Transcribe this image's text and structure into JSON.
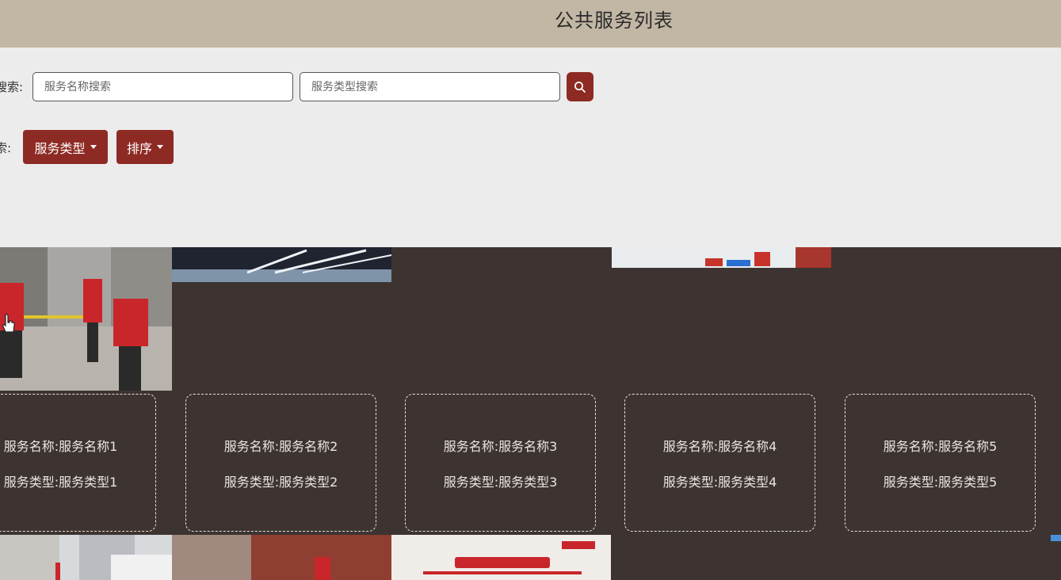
{
  "header": {
    "title": "公共服务列表"
  },
  "search": {
    "label": "搜索:",
    "name_placeholder": "服务名称搜索",
    "type_placeholder": "服务类型搜索",
    "button_icon": "search-icon"
  },
  "filter": {
    "label": "索:",
    "type_button": "服务类型",
    "sort_button": "排序"
  },
  "cards": [
    {
      "name": "服务名称:服务名称1",
      "type": "服务类型:服务类型1"
    },
    {
      "name": "服务名称:服务名称2",
      "type": "服务类型:服务类型2"
    },
    {
      "name": "服务名称:服务名称3",
      "type": "服务类型:服务类型3"
    },
    {
      "name": "服务名称:服务名称4",
      "type": "服务类型:服务类型4"
    },
    {
      "name": "服务名称:服务名称5",
      "type": "服务类型:服务类型5"
    }
  ],
  "colors": {
    "accent": "#8e2a24",
    "header_bg": "#c2b6a4",
    "page_bg": "#3d3431",
    "search_bg": "#ececec"
  }
}
